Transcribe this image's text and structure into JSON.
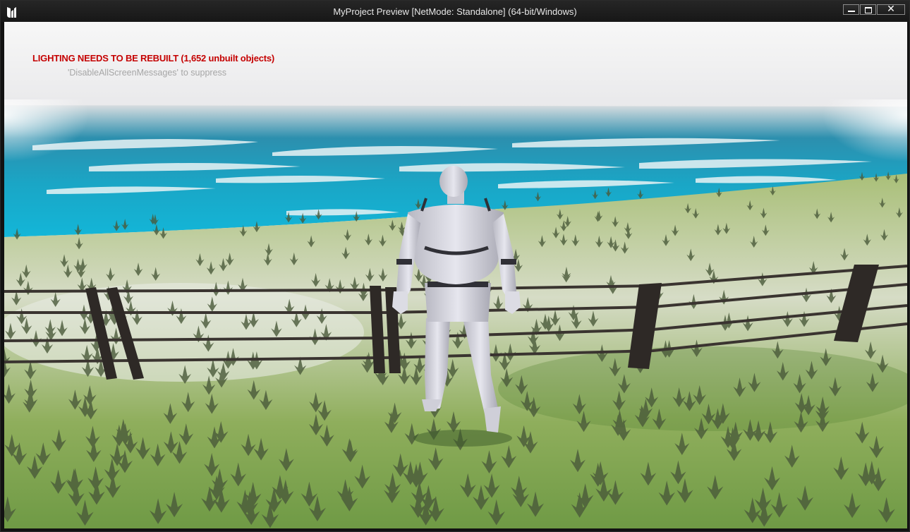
{
  "window": {
    "title": "MyProject Preview [NetMode: Standalone]  (64-bit/Windows)",
    "controls": {
      "minimize_icon": "minimize-icon",
      "maximize_icon": "maximize-icon",
      "close_label": "✕"
    }
  },
  "viewport": {
    "messages": {
      "lighting_warning": "LIGHTING NEEDS TO BE REBUILT (1,652 unbuilt objects)",
      "suppress_hint": "'DisableAllScreenMessages' to suppress"
    }
  },
  "colors": {
    "warning_text": "#c40000",
    "hint_text": "#a6a6a6",
    "sky": "#f2f2f2",
    "ocean": "#1a9fc0",
    "grass": "#8fae5c"
  }
}
